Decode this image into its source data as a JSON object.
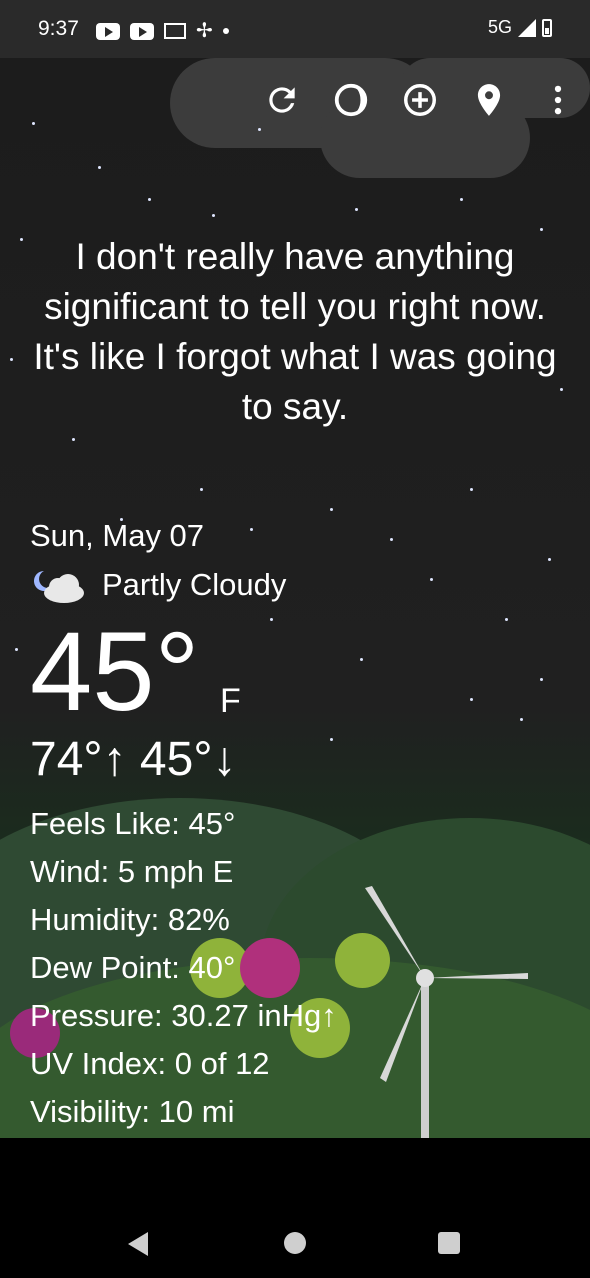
{
  "status_bar": {
    "time": "9:37",
    "network": "5G",
    "icons": [
      "youtube-icon",
      "youtube-icon",
      "gmail-icon",
      "pinwheel-icon",
      "dot-icon",
      "signal-icon",
      "battery-icon"
    ]
  },
  "toolbar": {
    "items": [
      "refresh-icon",
      "theme-icon",
      "add-location-icon",
      "location-pin-icon",
      "more-vert-icon"
    ]
  },
  "message": "I don't really have anything significant to tell you right now. It's like I forgot what I was going to say.",
  "weather": {
    "date": "Sun, May 07",
    "condition": "Partly Cloudy",
    "condition_icon": "partly-cloudy-night-icon",
    "temperature": "45°",
    "unit": "F",
    "high_low": "74°↑ 45°↓"
  },
  "details": [
    {
      "label": "Feels Like:",
      "value": "45°"
    },
    {
      "label": "Wind:",
      "value": "5 mph E"
    },
    {
      "label": "Humidity:",
      "value": "82%"
    },
    {
      "label": "Dew Point:",
      "value": "40°"
    },
    {
      "label": "Pressure:",
      "value": "30.27 inHg↑"
    },
    {
      "label": "UV Index:",
      "value": "0 of 12"
    },
    {
      "label": "Visibility:",
      "value": "10 mi"
    }
  ],
  "colors": {
    "status_bar_bg": "#2a2a2a",
    "sky": "#1c1c1c",
    "grass": "#2e4f2c",
    "text": "#ffffff"
  }
}
